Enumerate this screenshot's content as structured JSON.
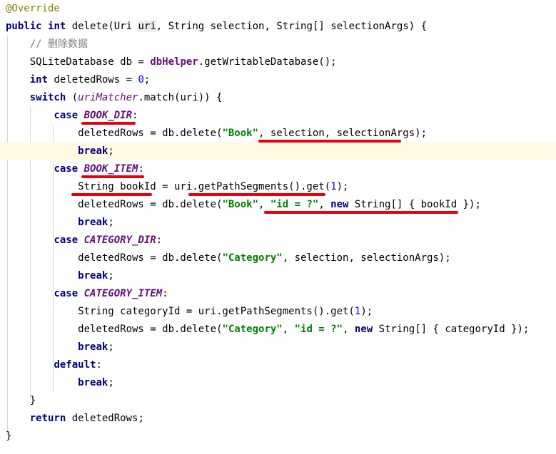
{
  "colors": {
    "keyword": "#000080",
    "annotation": "#808000",
    "comment": "#808080",
    "field": "#660e7a",
    "string": "#008000",
    "number": "#0000ff",
    "current_line": "#fffae3",
    "markup_underline": "#e8000a"
  },
  "code_lines": [
    [
      {
        "t": "@Override",
        "c": "ann"
      }
    ],
    [
      {
        "t": "public",
        "c": "kw"
      },
      {
        "t": " "
      },
      {
        "t": "int",
        "c": "kw"
      },
      {
        "t": " delete(Uri "
      },
      {
        "t": "uri",
        "c": "ref"
      },
      {
        "t": ", String selection, String[] selectionArgs) {"
      }
    ],
    [
      {
        "t": "    "
      },
      {
        "t": "// 删除数据",
        "c": "cm"
      }
    ],
    [
      {
        "t": "    SQLiteDatabase db = "
      },
      {
        "t": "dbHelper",
        "c": "field"
      },
      {
        "t": ".getWritableDatabase();"
      }
    ],
    [
      {
        "t": "    "
      },
      {
        "t": "int",
        "c": "kw"
      },
      {
        "t": " deletedRows = "
      },
      {
        "t": "0",
        "c": "num"
      },
      {
        "t": ";"
      }
    ],
    [
      {
        "t": "    "
      },
      {
        "t": "switch",
        "c": "kw"
      },
      {
        "t": " ("
      },
      {
        "t": "uriMatcher",
        "c": "ifield"
      },
      {
        "t": ".match(uri)) {"
      }
    ],
    [
      {
        "t": "        "
      },
      {
        "t": "case",
        "c": "kw"
      },
      {
        "t": " "
      },
      {
        "t": "BOOK_DIR",
        "c": "sfield"
      },
      {
        "t": ":"
      }
    ],
    [
      {
        "t": "            deletedRows = db.delete("
      },
      {
        "t": "\"Book\"",
        "c": "str"
      },
      {
        "t": ", selection, selectionArgs);"
      }
    ],
    [
      {
        "t": "            "
      },
      {
        "t": "break",
        "c": "kw"
      },
      {
        "t": ";"
      }
    ],
    [
      {
        "t": "        "
      },
      {
        "t": "case",
        "c": "kw"
      },
      {
        "t": " "
      },
      {
        "t": "BOOK_ITEM",
        "c": "sfield"
      },
      {
        "t": ":"
      }
    ],
    [
      {
        "t": "            String bookId = uri.getPathSegments().get("
      },
      {
        "t": "1",
        "c": "num"
      },
      {
        "t": ");"
      }
    ],
    [
      {
        "t": "            deletedRows = db.delete("
      },
      {
        "t": "\"Book\"",
        "c": "str"
      },
      {
        "t": ", "
      },
      {
        "t": "\"id = ?\"",
        "c": "str"
      },
      {
        "t": ", "
      },
      {
        "t": "new",
        "c": "kw"
      },
      {
        "t": " String[] { bookId });"
      }
    ],
    [
      {
        "t": "            "
      },
      {
        "t": "break",
        "c": "kw"
      },
      {
        "t": ";"
      }
    ],
    [
      {
        "t": "        "
      },
      {
        "t": "case",
        "c": "kw"
      },
      {
        "t": " "
      },
      {
        "t": "CATEGORY_DIR",
        "c": "sfield"
      },
      {
        "t": ":"
      }
    ],
    [
      {
        "t": "            deletedRows = db.delete("
      },
      {
        "t": "\"Category\"",
        "c": "str"
      },
      {
        "t": ", selection, selectionArgs);"
      }
    ],
    [
      {
        "t": "            "
      },
      {
        "t": "break",
        "c": "kw"
      },
      {
        "t": ";"
      }
    ],
    [
      {
        "t": "        "
      },
      {
        "t": "case",
        "c": "kw"
      },
      {
        "t": " "
      },
      {
        "t": "CATEGORY_ITEM",
        "c": "sfield"
      },
      {
        "t": ":"
      }
    ],
    [
      {
        "t": "            String categoryId = uri.getPathSegments().get("
      },
      {
        "t": "1",
        "c": "num"
      },
      {
        "t": ");"
      }
    ],
    [
      {
        "t": "            deletedRows = db.delete("
      },
      {
        "t": "\"Category\"",
        "c": "str"
      },
      {
        "t": ", "
      },
      {
        "t": "\"id = ?\"",
        "c": "str"
      },
      {
        "t": ", "
      },
      {
        "t": "new",
        "c": "kw"
      },
      {
        "t": " String[] { categoryId });"
      }
    ],
    [
      {
        "t": "            "
      },
      {
        "t": "break",
        "c": "kw"
      },
      {
        "t": ";"
      }
    ],
    [
      {
        "t": "        "
      },
      {
        "t": "default",
        "c": "kw"
      },
      {
        "t": ":"
      }
    ],
    [
      {
        "t": "            "
      },
      {
        "t": "break",
        "c": "kw"
      },
      {
        "t": ";"
      }
    ],
    [
      {
        "t": "    }"
      }
    ],
    [
      {
        "t": "    "
      },
      {
        "t": "return",
        "c": "kw"
      },
      {
        "t": " deletedRows;"
      }
    ],
    [
      {
        "t": "}"
      }
    ]
  ]
}
